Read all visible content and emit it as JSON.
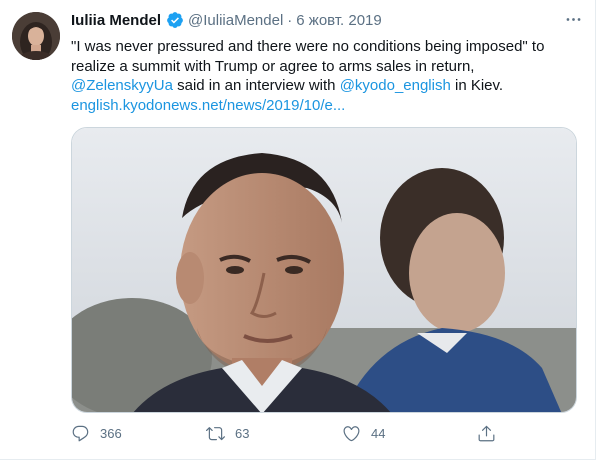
{
  "tweet": {
    "author_name": "Iuliia Mendel",
    "handle": "@IuliiaMendel",
    "separator": "·",
    "date": "6 жовт. 2019",
    "text_line1": "\"I was never pressured and there were no conditions being imposed\" to realize a summit with Trump or agree to arms sales in return, ",
    "mention1": "@ZelenskyyUa",
    "text_line2": " said in an interview with ",
    "mention2": "@kyodo_english",
    "text_line3": " in Kiev.",
    "link": "english.kyodonews.net/news/2019/10/e...",
    "icons": {
      "verified": "verified-badge-icon",
      "more": "more-options-icon",
      "reply": "reply-icon",
      "retweet": "retweet-icon",
      "like": "like-icon",
      "share": "share-icon"
    },
    "counts": {
      "replies": "366",
      "retweets": "63",
      "likes": "44"
    },
    "colors": {
      "link": "#1b95e0",
      "verified": "#1da1f2",
      "muted": "#5b7083"
    }
  }
}
